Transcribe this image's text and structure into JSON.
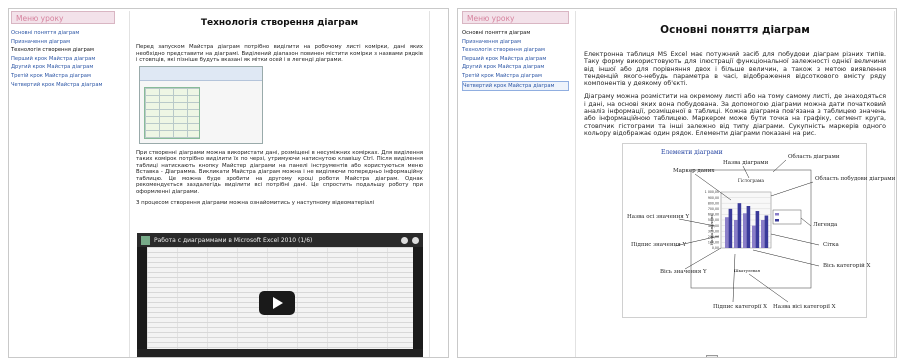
{
  "left_window": {
    "menu_title": "Меню уроку",
    "menu_items": [
      "Основні поняття діаграм",
      "Призначення діаграм",
      "Технологія створення діаграм",
      "Перший крок Майстра діаграм",
      "Другий крок Майстра діаграм",
      "Третій крок Майстра діаграм",
      "Четвертий крок Майстра діаграм"
    ],
    "page_title": "Технологія створення діаграм",
    "paragraph_1": "Перед запуском Майстра діаграм потрібно виділити на робочому листі комірки, дані яких необхідно представити на діаграмі. Виділений діапазон повинен містити комірки з назвами рядків і стовпців, які пізніше будуть вказані як мітки осей і в легенді діаграми.",
    "paragraph_2": "При створенні діаграми можна використати дані, розміщені в несуміжних комірках. Для виділення таких комірок потрібно виділити їх по черзі, утримуючи натиснутою клавішу Ctrl. Після виділення таблиці натискають кнопку Майстер діаграми на панелі інструментів або користуються меню Вставка - Діаграмма. Викликати Майстра діаграм можна і не виділяючи попередньо інформаційну таблицю. Це можна буде зробити на другому кроці роботи Майстра діаграм. Однак рекомендується заздалегідь виділити всі потрібні дані. Це спростить подальшу роботу при оформленні діаграми.",
    "paragraph_3": "З процесом створення діаграми можна ознайомитись у наступному відеоматеріалі",
    "video_title": "Работа с диаграммами в Microsoft Excel 2010 (1/6)"
  },
  "right_window": {
    "menu_title": "Меню уроку",
    "menu_items": [
      "Основні поняття діаграм",
      "Призначення діаграм",
      "Технологія створення діаграм",
      "Перший крок Майстра діаграм",
      "Другий крок Майстра діаграм",
      "Третій крок Майстра діаграм",
      "Четвертий крок Майстра діаграм"
    ],
    "page_title": "Основні поняття діаграм",
    "paragraph_1": "Електронна таблиця MS Excel має потужний засіб для побудови діаграм різних типів. Таку форму використовують для ілюстрації функціональної залежності однієї величини від іншої або для порівняння двох і більше величин, а також з метою виявлення тенденцій якого-небудь параметра в часі, відображення відсоткового вмісту ряду компонентів у деякому об'єкті.",
    "paragraph_2": "Діаграму можна розмістити на окремому листі або на тому самому листі, де знаходяться і дані, на основі яких вона побудована. За допомогою діаграми можна дати початковий аналіз інформації, розміщеної в таблиці. Кожна діаграма пов'язана з таблицею значень або інформаційною таблицею. Маркером може бути точка на графіку, сегмент круга, стовпчик гістограми та інші залежно від типу діаграми. Сукупність маркерів одного кольору відображає один рядок. Елементи діаграми показані на рис.",
    "figure": {
      "title": "Елементи діаграми",
      "labels": {
        "chart_name": "Назва діаграми",
        "chart_area": "Область діаграми",
        "data_marker": "Маркер даних",
        "plot_area": "Область побудови діаграми",
        "y_axis_title": "Назва осі значення Y",
        "legend": "Легенда",
        "y_axis_caption": "Підпис значення Y",
        "gridline": "Сітка",
        "x_axis_category": "Вісь категорій X",
        "y_axis_values": "Вісь значення Y",
        "x_category_caption": "Підпис категорії X",
        "x_axis_title": "Назва вісі категорії X",
        "inner_title": "Гістограма",
        "inner_ylabel": "Назва значень",
        "inner_xlabel": "Шкатулевая"
      },
      "ticks": [
        "1 000,00",
        "900,00",
        "800,00",
        "700,00",
        "600,00",
        "500,00",
        "400,00",
        "300,00",
        "200,00",
        "100,00",
        "0,00"
      ]
    }
  },
  "colors": {
    "menu_title": "#d6839e",
    "link": "#2b55a5",
    "series_1": "#8a7ec8",
    "series_2": "#3a3a9a"
  }
}
